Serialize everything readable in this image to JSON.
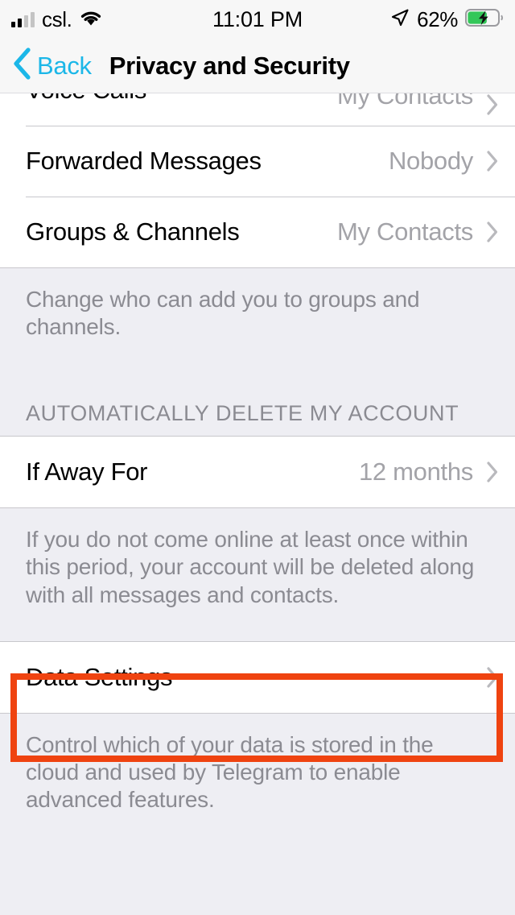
{
  "status_bar": {
    "carrier": "csl.",
    "time": "11:01 PM",
    "battery_percent": "62%",
    "signal_bars_filled": 2,
    "signal_bars_total": 4,
    "wifi_icon": "wifi-icon",
    "location_icon": "location-arrow-icon",
    "battery_icon": "battery-charging-icon",
    "battery_fill_ratio": 0.62
  },
  "nav_bar": {
    "back_label": "Back",
    "back_icon": "chevron-left-icon",
    "title": "Privacy and Security"
  },
  "list": {
    "rows": [
      {
        "title": "Voice Calls",
        "value": "My Contacts",
        "chevron": "chevron-right-icon"
      },
      {
        "title": "Forwarded Messages",
        "value": "Nobody",
        "chevron": "chevron-right-icon"
      },
      {
        "title": "Groups & Channels",
        "value": "My Contacts",
        "chevron": "chevron-right-icon"
      }
    ],
    "groups_footnote": "Change who can add you to groups and channels.",
    "section_header": "AUTOMATICALLY DELETE MY ACCOUNT",
    "if_away_row": {
      "title": "If Away For",
      "value": "12 months",
      "chevron": "chevron-right-icon"
    },
    "if_away_footnote": "If you do not come online at least once within this period, your account will be deleted along with all messages and contacts.",
    "data_settings_row": {
      "title": "Data Settings",
      "value": "",
      "chevron": "chevron-right-icon"
    },
    "data_settings_footnote": "Control which of your data is stored in the cloud and used by Telegram to enable advanced features."
  },
  "annotation": {
    "highlight_color": "#ef4310",
    "target": "data-settings-row"
  },
  "colors": {
    "accent": "#1cb7e8",
    "row_background": "#ffffff",
    "page_background": "#eeeef3",
    "secondary_text": "#8b8b92",
    "value_text": "#a3a3a8",
    "separator": "#c8c7cc",
    "battery_green": "#34c759"
  }
}
